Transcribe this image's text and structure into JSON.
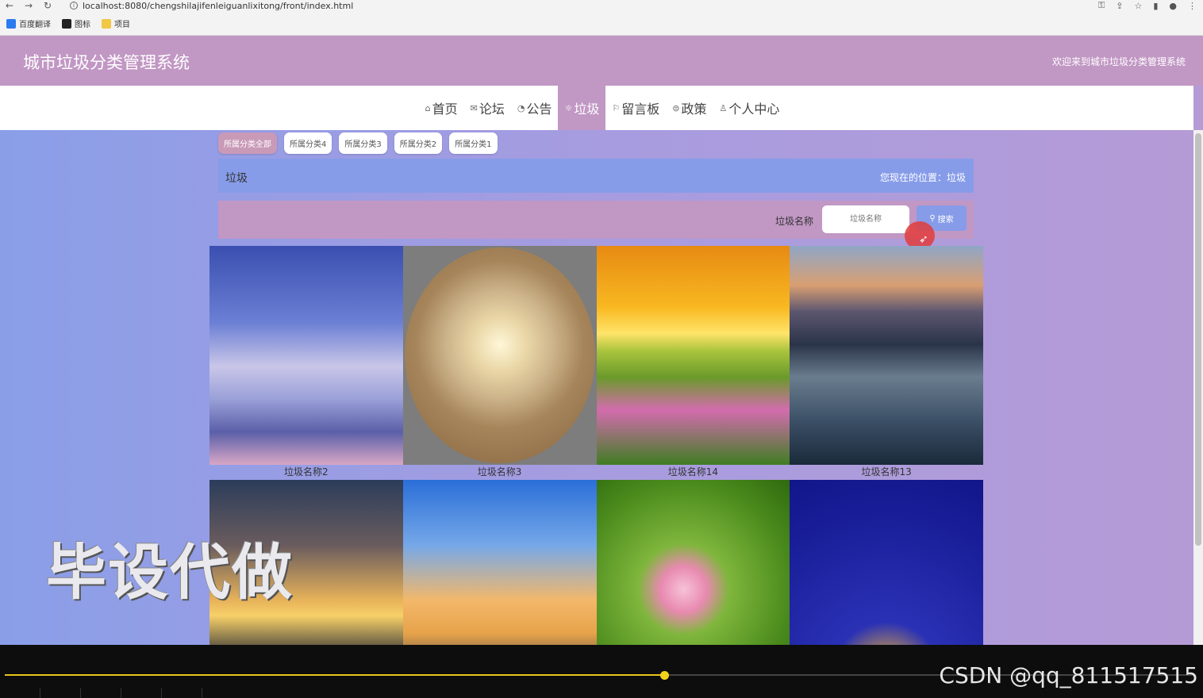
{
  "browser": {
    "url": "localhost:8080/chengshilajifenleiguanlixitong/front/index.html",
    "bookmarks": [
      {
        "label": "百度翻译",
        "color": "#2b7bf0"
      },
      {
        "label": "图标",
        "color": "#222222"
      },
      {
        "label": "项目",
        "color": "#f2c744"
      }
    ]
  },
  "site": {
    "title": "城市垃圾分类管理系统",
    "welcome": "欢迎来到城市垃圾分类管理系统"
  },
  "menu": [
    {
      "icon": "⌂",
      "label": "首页"
    },
    {
      "icon": "✉",
      "label": "论坛"
    },
    {
      "icon": "◔",
      "label": "公告"
    },
    {
      "icon": "☼",
      "label": "垃圾",
      "active": true
    },
    {
      "icon": "⚐",
      "label": "留言板"
    },
    {
      "icon": "⊜",
      "label": "政策"
    },
    {
      "icon": "♙",
      "label": "个人中心"
    }
  ],
  "filters": [
    "所属分类全部",
    "所属分类4",
    "所属分类3",
    "所属分类2",
    "所属分类1"
  ],
  "crumb": {
    "title": "垃圾",
    "location": "您现在的位置：垃圾"
  },
  "search": {
    "label": "垃圾名称",
    "placeholder": "垃圾名称",
    "button": "搜索"
  },
  "items": [
    {
      "name": "垃圾名称2"
    },
    {
      "name": "垃圾名称3"
    },
    {
      "name": "垃圾名称14"
    },
    {
      "name": "垃圾名称13"
    },
    {
      "name": ""
    },
    {
      "name": ""
    },
    {
      "name": ""
    },
    {
      "name": ""
    }
  ],
  "overlay": {
    "watermark": "毕设代做",
    "csdn": "CSDN @qq_811517515"
  },
  "player": {
    "progress": 0.555,
    "accent": "#e8c51a"
  }
}
